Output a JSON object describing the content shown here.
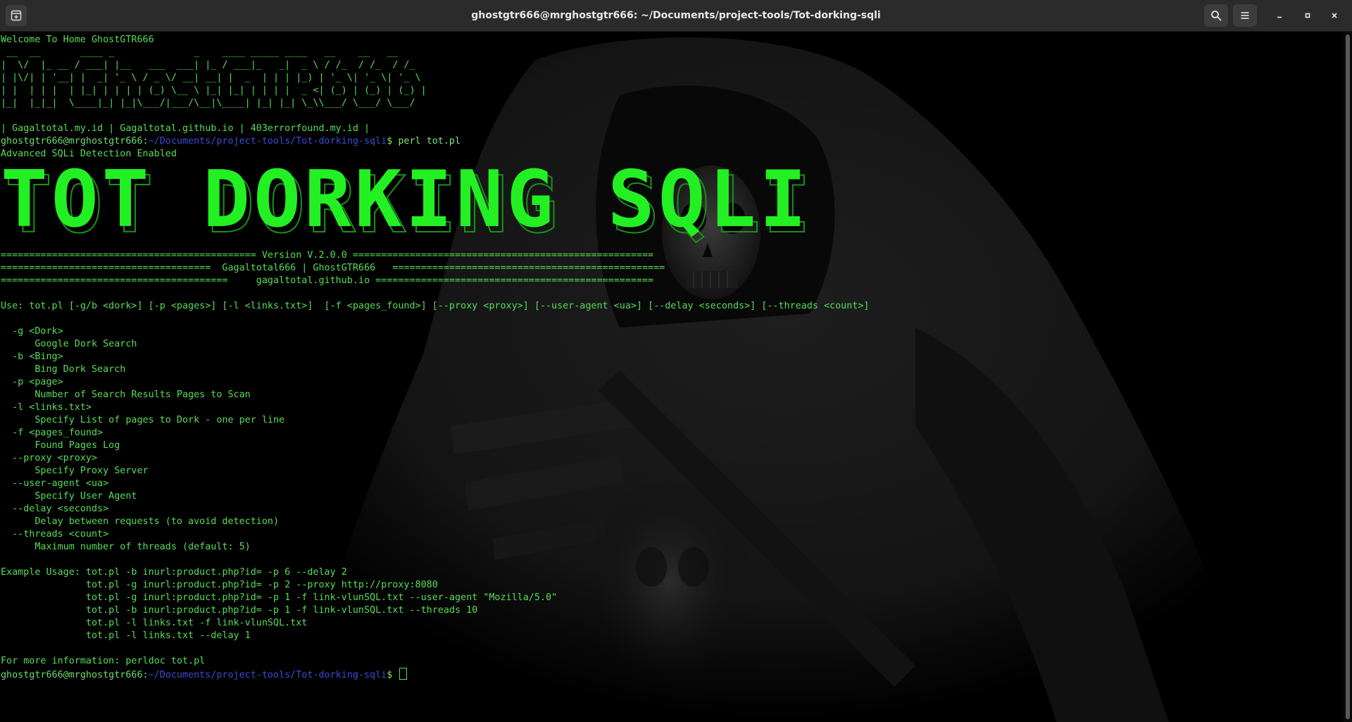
{
  "window": {
    "title": "ghostgtr666@mrghostgtr666: ~/Documents/project-tools/Tot-dorking-sqli"
  },
  "icons": {
    "new_tab": "new-tab-icon",
    "search": "search-icon",
    "menu": "hamburger-menu-icon",
    "minimize": "minimize-icon",
    "maximize": "maximize-icon",
    "close": "close-icon"
  },
  "colors": {
    "terminal_green": "#57dd57",
    "banner_green": "#22f022",
    "prompt_path": "#3b4bd6",
    "titlebar": "#2b2b2b"
  },
  "terminal": {
    "welcome": "Welcome To Home GhostGTR666",
    "ascii_art": [
      " __  __       ____ _              _    ____ _____ ____   __    __   __",
      "|  \\/  |_ __ / ___| |__   ___  ___| |_ / ___|_   _|  _ \\ / /_  / /_  / /_",
      "| |\\/| | '__| |  _| '_ \\ / _ \\/ __| __| |  _  | | | |_) | '_ \\| '_ \\| '_ \\",
      "| |  | | |  | |_| | | | | (_) \\__ \\ |_| |_| | | | |  _ <| (_) | (_) | (_) |",
      "|_|  |_|_|  \\____|_| |_|\\___/|___/\\__|\\____| |_| |_| \\_\\\\___/ \\___/ \\___/"
    ],
    "links_line": "| Gagaltotal.my.id | Gagaltotal.github.io | 403errorfound.my.id |",
    "prompt": {
      "user": "ghostgtr666@mrghostgtr666",
      "path": "~/Documents/project-tools/Tot-dorking-sqli",
      "symbol": "$",
      "command": "perl tot.pl"
    },
    "detection": "Advanced SQLi Detection Enabled",
    "banner": "TOT DORKING SQLI",
    "version_lines": [
      "============================================= Version V.2.0.0 =====================================================",
      "=====================================  Gagaltotal666 | GhostGTR666   ================================================",
      "========================================     gagaltotal.github.io ================================================="
    ],
    "usage": "Use: tot.pl [-g/b <dork>] [-p <pages>] [-l <links.txt>]  [-f <pages_found>] [--proxy <proxy>] [--user-agent <ua>] [--delay <seconds>] [--threads <count>]",
    "options": [
      {
        "flag": "-g <Dork>",
        "desc": "Google Dork Search"
      },
      {
        "flag": "-b <Bing>",
        "desc": "Bing Dork Search"
      },
      {
        "flag": "-p <page>",
        "desc": "Number of Search Results Pages to Scan"
      },
      {
        "flag": "-l <links.txt>",
        "desc": "Specify List of pages to Dork - one per line"
      },
      {
        "flag": "-f <pages_found>",
        "desc": "Found Pages Log"
      },
      {
        "flag": "--proxy <proxy>",
        "desc": "Specify Proxy Server"
      },
      {
        "flag": "--user-agent <ua>",
        "desc": "Specify User Agent"
      },
      {
        "flag": "--delay <seconds>",
        "desc": "Delay between requests (to avoid detection)"
      },
      {
        "flag": "--threads <count>",
        "desc": "Maximum number of threads (default: 5)"
      }
    ],
    "example_label": "Example Usage: ",
    "examples": [
      "tot.pl -b inurl:product.php?id= -p 6 --delay 2",
      "tot.pl -g inurl:product.php?id= -p 2 --proxy http://proxy:8080",
      "tot.pl -g inurl:product.php?id= -p 1 -f link-vlunSQL.txt --user-agent \"Mozilla/5.0\"",
      "tot.pl -b inurl:product.php?id= -p 1 -f link-vlunSQL.txt --threads 10",
      "tot.pl -l links.txt -f link-vlunSQL.txt",
      "tot.pl -l links.txt --delay 1"
    ],
    "more_info": "For more information: perldoc tot.pl"
  }
}
